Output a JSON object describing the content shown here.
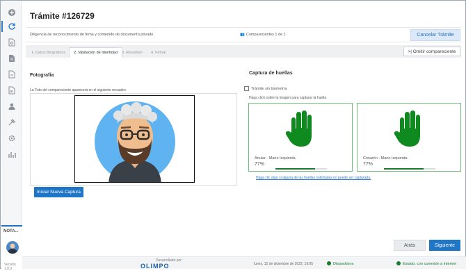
{
  "window": {
    "title": "Trámite #126729",
    "subtitle": "Diligencia de reconocimiento de firma y contenido de documento privado",
    "comparecientes": "Comparecientes 1 de 1",
    "cancel_label": "Cancelar Trámite"
  },
  "sidebar": {
    "items": [
      {
        "icon": "plus-circle-icon"
      },
      {
        "icon": "refresh-icon",
        "active": true
      },
      {
        "icon": "document-search-icon"
      },
      {
        "icon": "document-icon"
      },
      {
        "icon": "document-pdf-icon"
      },
      {
        "icon": "document-search-2-icon"
      },
      {
        "icon": "user-icon"
      },
      {
        "icon": "tools-icon"
      },
      {
        "icon": "gear-icon"
      },
      {
        "icon": "chart-icon"
      }
    ],
    "nota_label": "NOTA...",
    "version": "Versión 1.0.0"
  },
  "tabs": [
    {
      "label": "1. Datos Biográficos",
      "active": false
    },
    {
      "label": "2. Validación de Identidad",
      "active": true
    },
    {
      "label": "3. Resumen",
      "active": false
    },
    {
      "label": "4. Firmar",
      "active": false
    }
  ],
  "omit_label": ">| Omitir compareciente",
  "photo": {
    "section_title": "Fotografía",
    "hint": "La Foto del compareciente aparecerá en el siguiente recuadro",
    "capture_label": "Iniciar Nueva Captura"
  },
  "fingerprints": {
    "section_title": "Captura de huellas",
    "no_bio_label": "Trámite sin biometría",
    "hint": "Haga click sobre la imagen para capturar la huella",
    "cards": [
      {
        "label": "Anular - Mano Izquierda",
        "percent": "77%",
        "quality": 0.77
      },
      {
        "label": "Corazón - Mano Izquierda",
        "percent": "77%",
        "quality": 0.77
      }
    ],
    "link": "Haga clic aquí si alguna de las huellas solicitadas no puede ser capturada."
  },
  "buttons": {
    "back": "Atrás",
    "next": "Siguiente"
  },
  "footer": {
    "developed_by": "Desarrollado por",
    "brand": "OLIMPO",
    "date": "lunes, 12 de diciembre de 2022, 19:05",
    "devices": "Dispositivos",
    "status": "Estado: con conexión a internet"
  },
  "colors": {
    "primary": "#1f75c6",
    "success": "#1a7a2e",
    "hand": "#0f8a1f",
    "avatar_bg": "#5fb3f0"
  }
}
